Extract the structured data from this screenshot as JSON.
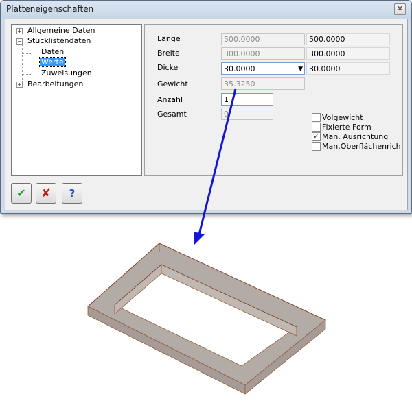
{
  "window": {
    "title": "Platteneigenschaften",
    "close_glyph": "✕"
  },
  "tree": {
    "expand_glyph": "+",
    "collapse_glyph": "−",
    "items": [
      {
        "label": "Allgemeine Daten"
      },
      {
        "label": "Stücklistendaten"
      },
      {
        "label": "Daten"
      },
      {
        "label": "Werte"
      },
      {
        "label": "Zuweisungen"
      },
      {
        "label": "Bearbeitungen"
      }
    ]
  },
  "panel": {
    "laenge": {
      "label": "Länge",
      "value": "500.0000",
      "result": "500.0000"
    },
    "breite": {
      "label": "Breite",
      "value": "300.0000",
      "result": "300.0000"
    },
    "dicke": {
      "label": "Dicke",
      "value": "30.0000",
      "result": "30.0000"
    },
    "gewicht": {
      "label": "Gewicht",
      "value": "35.3250"
    },
    "anzahl": {
      "label": "Anzahl",
      "value": "1"
    },
    "gesamt": {
      "label": "Gesamt",
      "value": "0"
    },
    "checkboxes": [
      {
        "label": "Volgewicht",
        "checked": false,
        "mark": ""
      },
      {
        "label": "Fixierte Form",
        "checked": false,
        "mark": ""
      },
      {
        "label": "Man. Ausrichtung",
        "checked": true,
        "mark": "✓"
      },
      {
        "label": "Man.Oberflächenrich",
        "checked": false,
        "mark": ""
      }
    ]
  },
  "buttons": {
    "ok_glyph": "✔",
    "cancel_glyph": "✘",
    "help_glyph": "?"
  },
  "colors": {
    "arrow": "#1515d6",
    "plate_fill": "#b3aba6",
    "plate_edge": "#9a5a3a"
  }
}
